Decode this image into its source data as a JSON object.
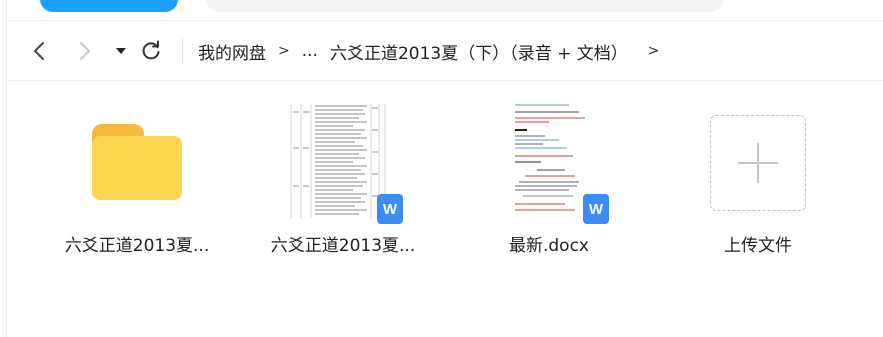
{
  "nav": {
    "breadcrumbs": [
      "我的网盘",
      "...",
      "六爻正道2013夏（下）（录音 + 文档）"
    ],
    "separator": ">"
  },
  "files": [
    {
      "name": "六爻正道2013夏...",
      "type": "folder",
      "icon": "folder-icon"
    },
    {
      "name": "六爻正道2013夏...",
      "type": "wps-doc",
      "icon": "wps-icon",
      "badge": "W"
    },
    {
      "name": "最新.docx",
      "type": "wps-doc",
      "icon": "wps-icon",
      "badge": "W"
    },
    {
      "name": "上传文件",
      "type": "upload",
      "icon": "plus-icon"
    }
  ],
  "colors": {
    "accent": "#1aa0ff",
    "folder": "#ffd54f",
    "wps": "#3b8df5"
  }
}
